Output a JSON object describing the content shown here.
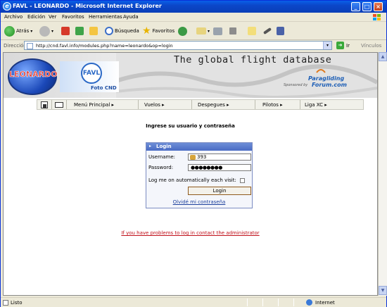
{
  "window": {
    "title": "FAVL - LEONARDO - Microsoft Internet Explorer"
  },
  "menu": [
    "Archivo",
    "Edición",
    "Ver",
    "Favoritos",
    "Herramientas",
    "Ayuda"
  ],
  "toolbar": {
    "back": "Atrás",
    "search": "Búsqueda",
    "favorites": "Favoritos"
  },
  "address": {
    "label": "Dirección",
    "url": "http://cnd.favl.info/modules.php?name=leonardo&op=login",
    "go": "Ir",
    "links": "Vínculos"
  },
  "banner": {
    "tagline": "The global flight database",
    "leonardo": "LEONARDO",
    "favl": "FAVL",
    "favl_sub": "Foto CND",
    "sponsored": "Sponsored by",
    "pg_line1": "Paragliding",
    "pg_line2": "Forum.com"
  },
  "nav": [
    "Menú Principal",
    "Vuelos",
    "Despegues",
    "Pilotos",
    "Liga XC"
  ],
  "login": {
    "heading": "Ingrese su usuario y contraseña",
    "box_title": "Login",
    "username_label": "Username:",
    "username_value": "393",
    "password_label": "Password:",
    "password_value": "●●●●●●●●",
    "remember_label": "Log me on automatically each visit:",
    "button": "Login",
    "forgot": "Olvidé mi contraseña"
  },
  "problem_link": "If you have problems to log in contact the administrator",
  "status": {
    "text": "Listo",
    "zone": "Internet"
  }
}
